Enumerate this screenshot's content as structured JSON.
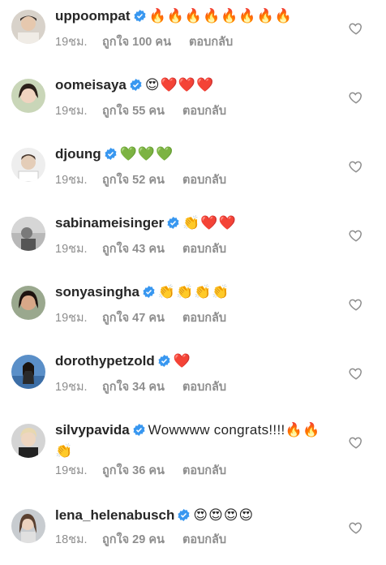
{
  "colors": {
    "verified": "#3897f0",
    "meta_text": "#8e8e8e",
    "username": "#262626"
  },
  "comments": [
    {
      "username": "uppoompat",
      "text": "🔥🔥🔥🔥🔥🔥🔥🔥",
      "time": "19ชม.",
      "likes": "ถูกใจ 100 คน",
      "reply": "ตอบกลับ"
    },
    {
      "username": "oomeisaya",
      "text": "😍❤️❤️❤️",
      "time": "19ชม.",
      "likes": "ถูกใจ 55 คน",
      "reply": "ตอบกลับ"
    },
    {
      "username": "djoung",
      "text": "💚💚💚",
      "time": "19ชม.",
      "likes": "ถูกใจ 52 คน",
      "reply": "ตอบกลับ"
    },
    {
      "username": "sabinameisinger",
      "text": "👏❤️❤️",
      "time": "19ชม.",
      "likes": "ถูกใจ 43 คน",
      "reply": "ตอบกลับ"
    },
    {
      "username": "sonyasingha",
      "text": "👏👏👏👏",
      "time": "19ชม.",
      "likes": "ถูกใจ 47 คน",
      "reply": "ตอบกลับ"
    },
    {
      "username": "dorothypetzold",
      "text": "❤️",
      "time": "19ชม.",
      "likes": "ถูกใจ 34 คน",
      "reply": "ตอบกลับ"
    },
    {
      "username": "silvypavida",
      "text": "Wowwww congrats!!!!🔥🔥👏",
      "time": "19ชม.",
      "likes": "ถูกใจ 36 คน",
      "reply": "ตอบกลับ"
    },
    {
      "username": "lena_helenabusch",
      "text": "😍😍😍😍",
      "time": "18ชม.",
      "likes": "ถูกใจ 29 คน",
      "reply": "ตอบกลับ"
    }
  ]
}
